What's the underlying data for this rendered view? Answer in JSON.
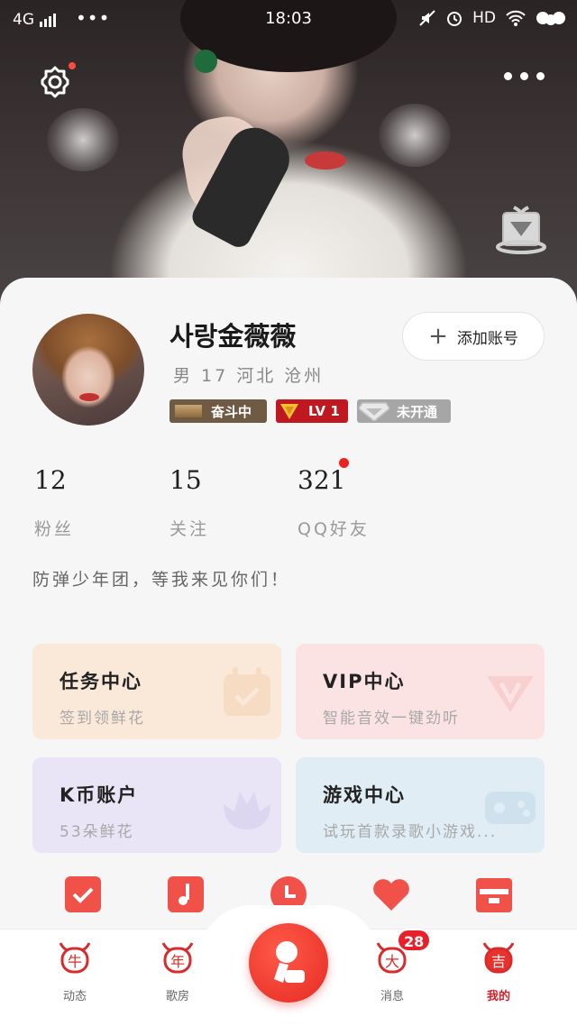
{
  "status_bar": {
    "network": "4G",
    "time": "18:03",
    "hd": "HD"
  },
  "profile": {
    "username": "사랑金薇薇",
    "info": "男 17 河北 沧州",
    "badges": {
      "status": "奋斗中",
      "level": "LV 1",
      "vip": "未开通"
    },
    "add_account_label": "添加账号",
    "bio": "防弹少年团，等我来见你们！"
  },
  "stats": [
    {
      "value": "12",
      "label": "粉丝"
    },
    {
      "value": "15",
      "label": "关注"
    },
    {
      "value": "321",
      "label": "QQ好友"
    }
  ],
  "tiles": {
    "task": {
      "title": "任务中心",
      "subtitle": "签到领鲜花"
    },
    "vip": {
      "title": "VIP中心",
      "subtitle": "智能音效一键劲听"
    },
    "kcoin": {
      "title": "K币账户",
      "subtitle": "53朵鲜花"
    },
    "game": {
      "title": "游戏中心",
      "subtitle": "试玩首款录歌小游戏..."
    }
  },
  "bottom_nav": {
    "items": [
      {
        "label": "动态",
        "glyph": "牛"
      },
      {
        "label": "歌房",
        "glyph": "年"
      },
      {
        "label": "消息",
        "glyph": "大"
      },
      {
        "label": "我的",
        "glyph": "吉"
      }
    ],
    "message_count": "28"
  },
  "colors": {
    "accent_red": "#e52a22",
    "task_tile": "#fae8d8",
    "vip_tile": "#fce3e3",
    "kcoin_tile": "#e9e5f6",
    "game_tile": "#e1edf4"
  }
}
